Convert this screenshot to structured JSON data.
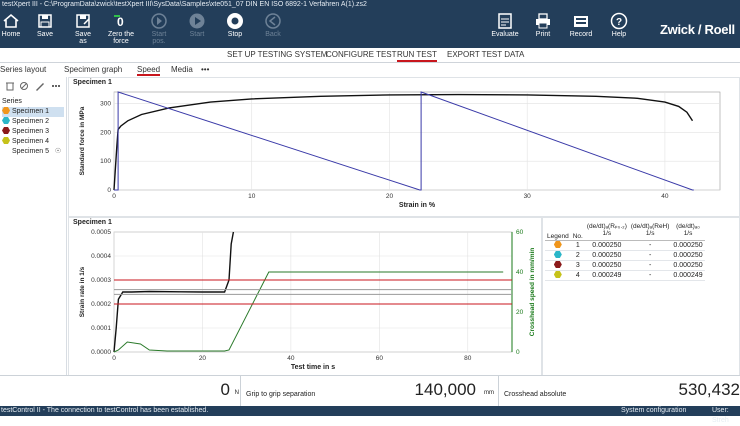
{
  "titlebar": {
    "text": "testXpert III - C:\\ProgramData\\zwick\\testXpert III\\SysData\\Samples\\xte051_07 DIN EN ISO 6892-1 Verfahren A(1).zs2"
  },
  "ribbon": {
    "buttons": [
      {
        "label": "Home",
        "icon": "home-icon",
        "enabled": true
      },
      {
        "label": "Save",
        "icon": "save-icon",
        "enabled": true
      },
      {
        "label": "Save\nas",
        "icon": "save-as-icon",
        "enabled": true
      },
      {
        "label": "Zero the\nforce",
        "icon": "zero-force-icon",
        "enabled": true
      },
      {
        "label": "Start\npos.",
        "icon": "start-position-icon",
        "enabled": false
      },
      {
        "label": "Start",
        "icon": "play-icon",
        "enabled": false
      },
      {
        "label": "Stop",
        "icon": "stop-icon",
        "enabled": true
      },
      {
        "label": "Back",
        "icon": "back-icon",
        "enabled": false
      },
      {
        "label": "Evaluate",
        "icon": "evaluate-icon",
        "enabled": true
      },
      {
        "label": "Print",
        "icon": "print-icon",
        "enabled": true
      },
      {
        "label": "Record",
        "icon": "record-icon",
        "enabled": true
      },
      {
        "label": "Help",
        "icon": "help-icon",
        "enabled": true
      }
    ],
    "brand": "Zwick / Roell"
  },
  "nav": {
    "tabs": [
      "SET UP TESTING SYSTEM",
      "CONFIGURE TEST",
      "RUN TEST",
      "EXPORT TEST DATA"
    ],
    "active": "RUN TEST"
  },
  "subtabs": {
    "items": [
      "Series layout",
      "Specimen graph",
      "Speed",
      "Media",
      "•••"
    ],
    "active": "Speed"
  },
  "sidebar": {
    "header": "Series",
    "specimens": [
      {
        "label": "Specimen 1",
        "color": "#f0961c"
      },
      {
        "label": "Specimen 2",
        "color": "#2bb6c8"
      },
      {
        "label": "Specimen 3",
        "color": "#8b1a1a"
      },
      {
        "label": "Specimen 4",
        "color": "#c6c21a"
      },
      {
        "label": "Specimen 5",
        "color": "#ffffff"
      }
    ]
  },
  "chart_data": [
    {
      "type": "line",
      "title": "Specimen 1",
      "xlabel": "Strain in %",
      "ylabel": "Standard force in MPa",
      "xlim": [
        0,
        44
      ],
      "ylim": [
        0,
        340
      ],
      "xticks": [
        0,
        10,
        20,
        30,
        40
      ],
      "yticks": [
        0,
        100,
        200,
        300
      ],
      "grid": true,
      "series": [
        {
          "color": "#111111",
          "x": [
            0,
            0.2,
            0.3,
            0.5,
            1,
            2,
            4,
            7,
            10,
            15,
            20,
            25,
            30,
            35,
            38,
            40,
            41,
            41.6,
            42
          ],
          "y": [
            0,
            150,
            210,
            222,
            240,
            262,
            285,
            305,
            316,
            325,
            330,
            331,
            330,
            325,
            318,
            305,
            290,
            270,
            240
          ]
        },
        {
          "color": "#3a3aa8",
          "x": [
            0,
            0.3,
            0.3,
            22.2,
            22.3,
            22.3,
            42,
            42.1,
            42.1
          ],
          "y": [
            0,
            0,
            340,
            0,
            0,
            340,
            0,
            0,
            0
          ]
        }
      ]
    },
    {
      "type": "line",
      "title": "Specimen 1",
      "xlabel": "Test time in s",
      "ylabel": "Strain rate in 1/s",
      "y2label": "Crosshead speed in mm/min",
      "xlim": [
        0,
        90
      ],
      "ylim": [
        0,
        0.0005
      ],
      "y2lim": [
        0,
        60
      ],
      "xticks": [
        0,
        20,
        40,
        60,
        80
      ],
      "yticks": [
        0,
        0.0001,
        0.0002,
        0.0003,
        0.0004,
        0.0005
      ],
      "ytick_labels": [
        "0.0000",
        "0.0001",
        "0.0002",
        "0.0003",
        "0.0004",
        "0.0005"
      ],
      "y2ticks": [
        0,
        20,
        40,
        60
      ],
      "grid": true,
      "series": [
        {
          "color": "#111111",
          "x": [
            0,
            0.5,
            1,
            2,
            4,
            8,
            15,
            20,
            25,
            26,
            26.5,
            27
          ],
          "y": [
            0,
            0.0001,
            0.00022,
            0.00025,
            0.00025,
            0.000252,
            0.000251,
            0.00025,
            0.00025,
            0.0003,
            0.00045,
            0.0005
          ]
        },
        {
          "color": "#2a7a2a",
          "axis": "y2",
          "x": [
            0,
            1,
            3,
            6,
            8,
            12,
            25,
            26,
            35,
            36,
            88
          ],
          "y": [
            0,
            1,
            5,
            4,
            1,
            0.5,
            0.5,
            1,
            40,
            40,
            40
          ]
        },
        {
          "color": "#c8161d",
          "x": [
            0,
            90
          ],
          "y": [
            0.0003,
            0.0003
          ]
        },
        {
          "color": "#c8161d",
          "x": [
            0,
            90
          ],
          "y": [
            0.0002,
            0.0002
          ]
        },
        {
          "color": "#999999",
          "x": [
            0,
            90
          ],
          "y": [
            0.00026,
            0.00026
          ]
        },
        {
          "color": "#999999",
          "x": [
            0,
            90
          ],
          "y": [
            0.00024,
            0.00024
          ]
        }
      ]
    }
  ],
  "table": {
    "headers": [
      "Legend",
      "No.",
      "(de/dt)ₐ(Rₚ₀.₂)",
      "(de/dt)ₐ(ReH)",
      "(de/dt)ₐ₀"
    ],
    "header_units": [
      "",
      "",
      "1/s",
      "1/s",
      "1/s"
    ],
    "rows": [
      {
        "color": "#f0961c",
        "no": "1",
        "a": "0.000250",
        "b": "-",
        "c": "0.000250"
      },
      {
        "color": "#2bb6c8",
        "no": "2",
        "a": "0.000250",
        "b": "-",
        "c": "0.000250"
      },
      {
        "color": "#8b1a1a",
        "no": "3",
        "a": "0.000250",
        "b": "-",
        "c": "0.000250"
      },
      {
        "color": "#c6c21a",
        "no": "4",
        "a": "0.000249",
        "b": "-",
        "c": "0.000249"
      }
    ]
  },
  "status": {
    "force_value": "0",
    "force_unit": "N",
    "grip_label": "Grip to grip separation",
    "grip_value": "140,000",
    "grip_unit": "mm",
    "crosshead_label": "Crosshead absolute",
    "crosshead_value": "530,432"
  },
  "bottombar": {
    "message": "testControl II - The connection to testControl has been established.",
    "config": "System configuration",
    "user": "User: Streh"
  }
}
